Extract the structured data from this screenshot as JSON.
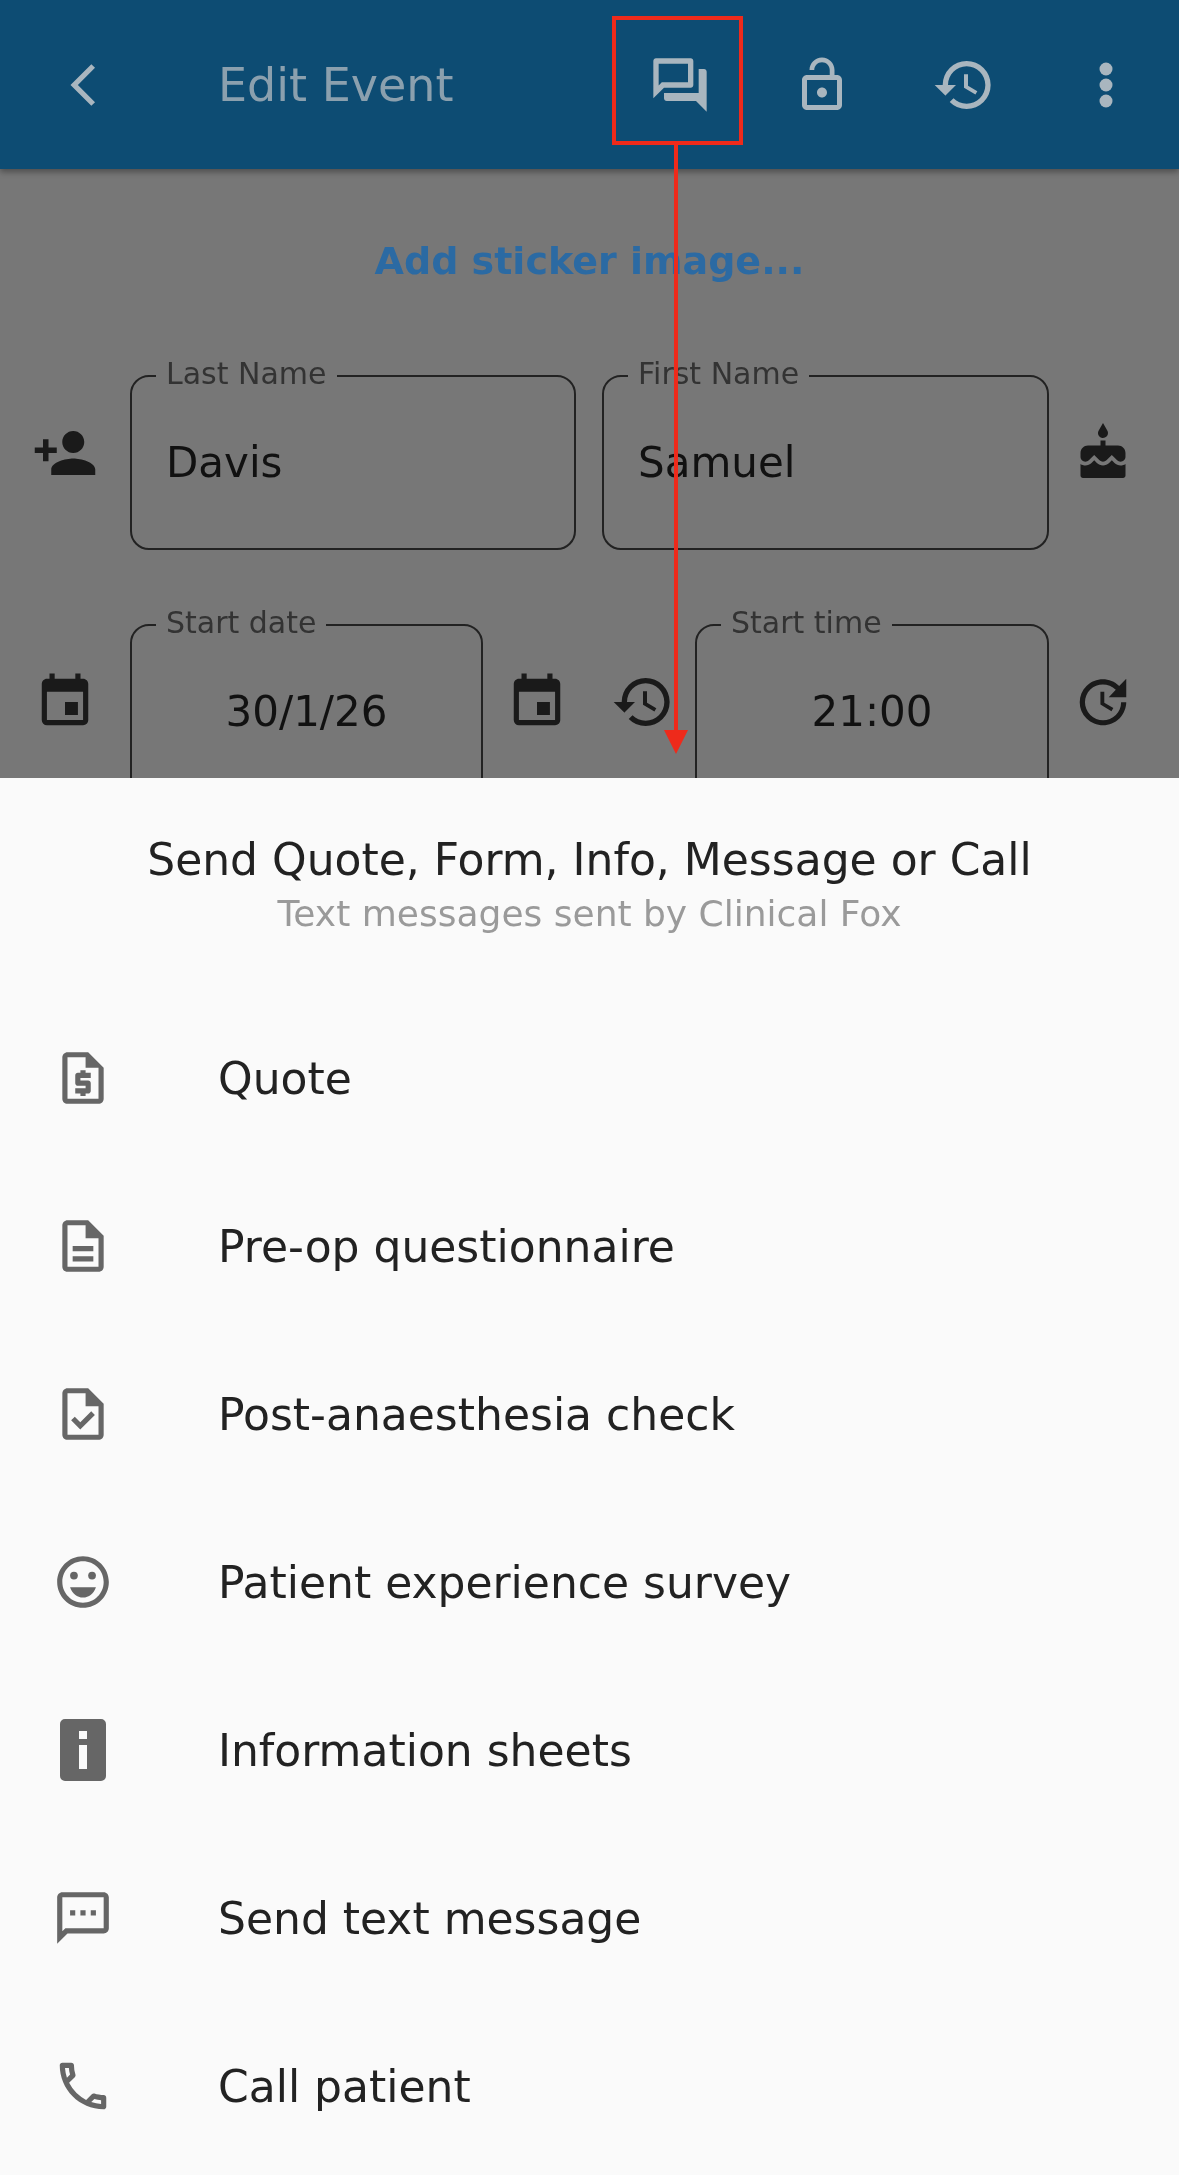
{
  "app_bar": {
    "title": "Edit Event"
  },
  "content": {
    "sticker_link": "Add sticker image...",
    "fields": [
      {
        "label": "Last Name",
        "value": "Davis"
      },
      {
        "label": "First Name",
        "value": "Samuel"
      },
      {
        "label": "Start date",
        "value": "30/1/26"
      },
      {
        "label": "Start time",
        "value": "21:00"
      }
    ]
  },
  "sheet": {
    "title": "Send Quote, Form, Info, Message or Call",
    "subtitle": "Text messages sent by Clinical Fox",
    "items": [
      "Quote",
      "Pre-op questionnaire",
      "Post-anaesthesia check",
      "Patient experience survey",
      "Information sheets",
      "Send text message",
      "Call patient"
    ]
  }
}
